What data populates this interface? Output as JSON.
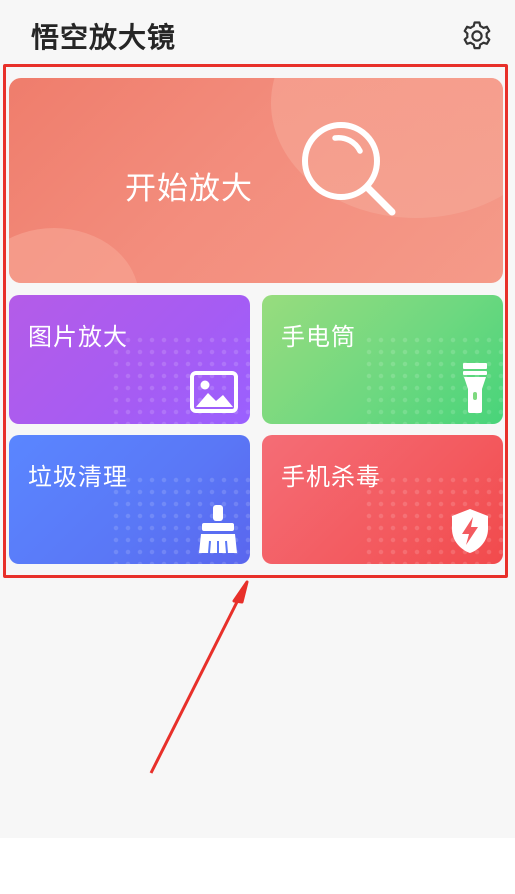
{
  "header": {
    "title": "悟空放大镜",
    "settings_icon": "gear-icon"
  },
  "hero": {
    "label": "开始放大",
    "icon": "magnifier-icon"
  },
  "tiles": [
    {
      "label": "图片放大",
      "icon": "image-icon"
    },
    {
      "label": "手电筒",
      "icon": "flashlight-icon"
    },
    {
      "label": "垃圾清理",
      "icon": "broom-icon"
    },
    {
      "label": "手机杀毒",
      "icon": "shield-bolt-icon"
    }
  ],
  "colors": {
    "highlight_frame": "#e8302a",
    "annotation_arrow": "#e8302a",
    "hero": "#f38d7d",
    "image_tile": "#a65cf3",
    "torch_tile": "#6fd880",
    "clean_tile": "#5a77f6",
    "virus_tile": "#f35a5f"
  }
}
